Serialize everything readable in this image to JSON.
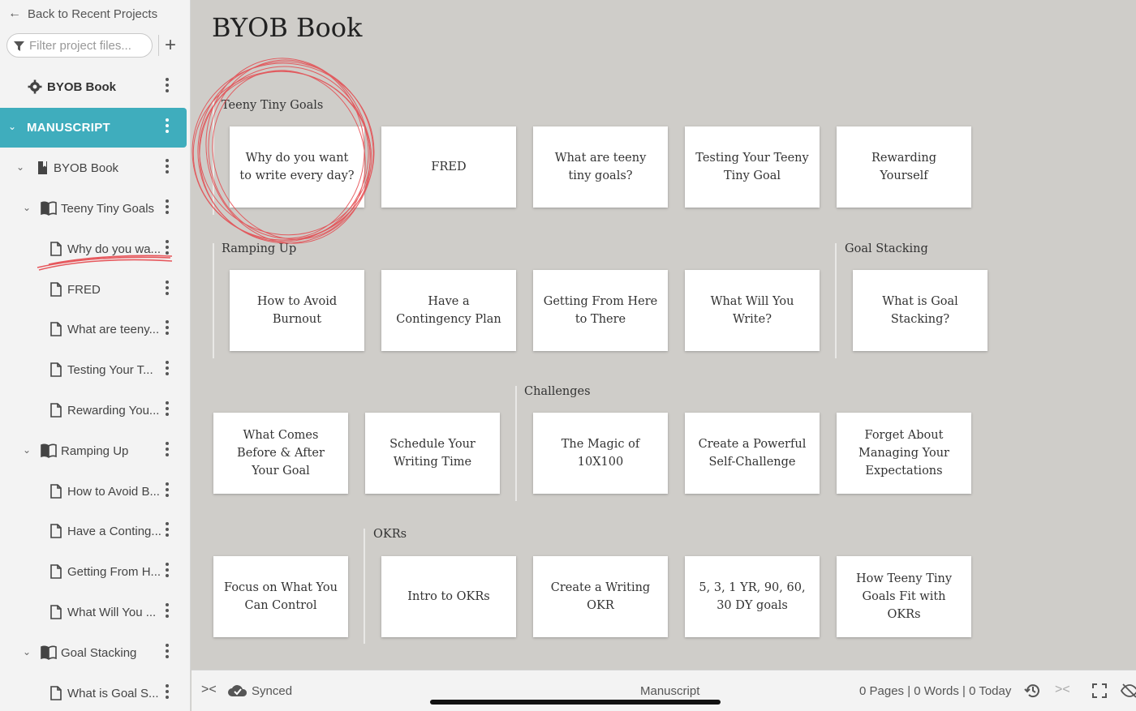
{
  "sidebar": {
    "back_label": "Back to Recent Projects",
    "filter_placeholder": "Filter project files...",
    "project_name": "BYOB Book",
    "manuscript_label": "MANUSCRIPT",
    "book_label": "BYOB Book",
    "items": [
      {
        "label": "Teeny Tiny Goals",
        "kind": "chapter"
      },
      {
        "label": "Why do you wa...",
        "kind": "doc"
      },
      {
        "label": "FRED",
        "kind": "doc"
      },
      {
        "label": "What are teeny...",
        "kind": "doc"
      },
      {
        "label": "Testing Your T...",
        "kind": "doc"
      },
      {
        "label": "Rewarding You...",
        "kind": "doc"
      },
      {
        "label": "Ramping Up",
        "kind": "chapter"
      },
      {
        "label": "How to Avoid B...",
        "kind": "doc"
      },
      {
        "label": "Have a Conting...",
        "kind": "doc"
      },
      {
        "label": "Getting From H...",
        "kind": "doc"
      },
      {
        "label": "What Will You ...",
        "kind": "doc"
      },
      {
        "label": "Goal Stacking",
        "kind": "chapter"
      },
      {
        "label": "What is Goal S...",
        "kind": "doc"
      }
    ]
  },
  "main": {
    "title": "BYOB Book",
    "groups": [
      {
        "label": "Teeny Tiny Goals"
      },
      {
        "label": "Ramping Up"
      },
      {
        "label": "Goal Stacking"
      },
      {
        "label": "Challenges"
      },
      {
        "label": "OKRs"
      }
    ],
    "cards": [
      "Why do you want to write every day?",
      "FRED",
      "What are teeny tiny goals?",
      "Testing Your Teeny Tiny Goal",
      "Rewarding Yourself",
      "How to Avoid Burnout",
      "Have a Contingency Plan",
      "Getting From Here to There",
      "What Will You Write?",
      "What is Goal Stacking?",
      "What Comes Before & After Your Goal",
      "Schedule Your Writing Time",
      "The Magic of 10X100",
      "Create a Powerful Self-Challenge",
      "Forget About Managing Your Expectations",
      "Focus on What You Can Control",
      "Intro to OKRs",
      "Create a Writing OKR",
      "5, 3, 1 YR, 90, 60, 30 DY goals",
      "How Teeny Tiny Goals Fit with OKRs"
    ]
  },
  "statusbar": {
    "sync_label": "Synced",
    "section_label": "Manuscript",
    "stats": "0 Pages | 0 Words | 0 Today"
  },
  "colors": {
    "accent": "#3fadbd",
    "canvas": "#cfcdc9",
    "scribble": "#e5484d"
  }
}
